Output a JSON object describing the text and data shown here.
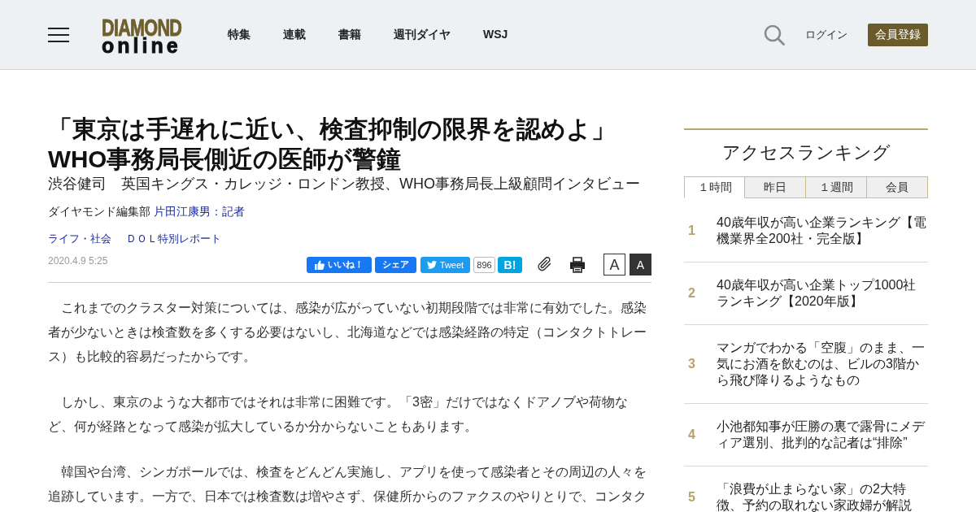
{
  "header": {
    "logo": {
      "line_1": "DIAMOND",
      "line_2": "online"
    },
    "nav": [
      "特集",
      "連載",
      "書籍",
      "週刊ダイヤ",
      "WSJ"
    ],
    "login": "ログイン",
    "register_button": "会員登録"
  },
  "article": {
    "title": "「東京は手遅れに近い、検査抑制の限界を認めよ」WHO事務局長側近の医師が警鐘",
    "subtitle": "渋谷健司　英国キングス・カレッジ・ロンドン教授、WHO事務局長上級顧問インタビュー",
    "byline": {
      "department": "ダイヤモンド編集部",
      "author": "片田江康男：記者"
    },
    "categories": [
      "ライフ・社会",
      "ＤＯＬ特別レポート"
    ],
    "date": "2020.4.9 5:25",
    "share_buttons": [
      {
        "kind": "like",
        "label": "いいね！"
      },
      {
        "kind": "share",
        "label": "シェア"
      },
      {
        "kind": "tweet",
        "label": "Tweet",
        "count": "896"
      },
      {
        "kind": "hatena",
        "label": "B!"
      }
    ],
    "text_size": [
      {
        "kind": "large",
        "label": "A",
        "selected": false
      },
      {
        "kind": "small",
        "label": "A",
        "selected": true
      }
    ],
    "paragraphs": [
      "これまでのクラスター対策については、感染が広がっていない初期段階では非常に有効でした。感染者が少ないときは検査数を多くする必要はないし、北海道などでは感染経路の特定（コンタクトトレース）も比較的容易だったからです。",
      "しかし、東京のような大都市ではそれは非常に困難です。「3密」だけではなくドアノブや荷物など、何が経路となって感染が拡大しているか分からないこともあります。",
      "韓国や台湾、シンガポールでは、検査をどんどん実施し、アプリを使って感染者とその周辺の人々を追跡しています。一方で、日本では検査数は増やさず、保健所からのファクスのやりとりで、コンタク"
    ]
  },
  "ranking": {
    "title": "アクセスランキング",
    "tabs": [
      {
        "label": "１時間",
        "selected": true
      },
      {
        "label": "昨日",
        "selected": false
      },
      {
        "label": "１週間",
        "selected": false
      },
      {
        "label": "会員",
        "selected": false
      }
    ],
    "items": [
      {
        "rank": "1",
        "title": "40歳年収が高い企業ランキング【電機業界全200社・完全版】"
      },
      {
        "rank": "2",
        "title": "40歳年収が高い企業トップ1000社ランキング【2020年版】"
      },
      {
        "rank": "3",
        "title": "マンガでわかる「空腹」のまま、一気にお酒を飲むのは、ビルの3階から飛び降りるようなもの"
      },
      {
        "rank": "4",
        "title": "小池都知事が圧勝の裏で露骨にメディア選別、批判的な記者は“排除”"
      },
      {
        "rank": "5",
        "title": "「浪費が止まらない家」の2大特徴、予約の取れない家政婦が解説"
      }
    ]
  }
}
